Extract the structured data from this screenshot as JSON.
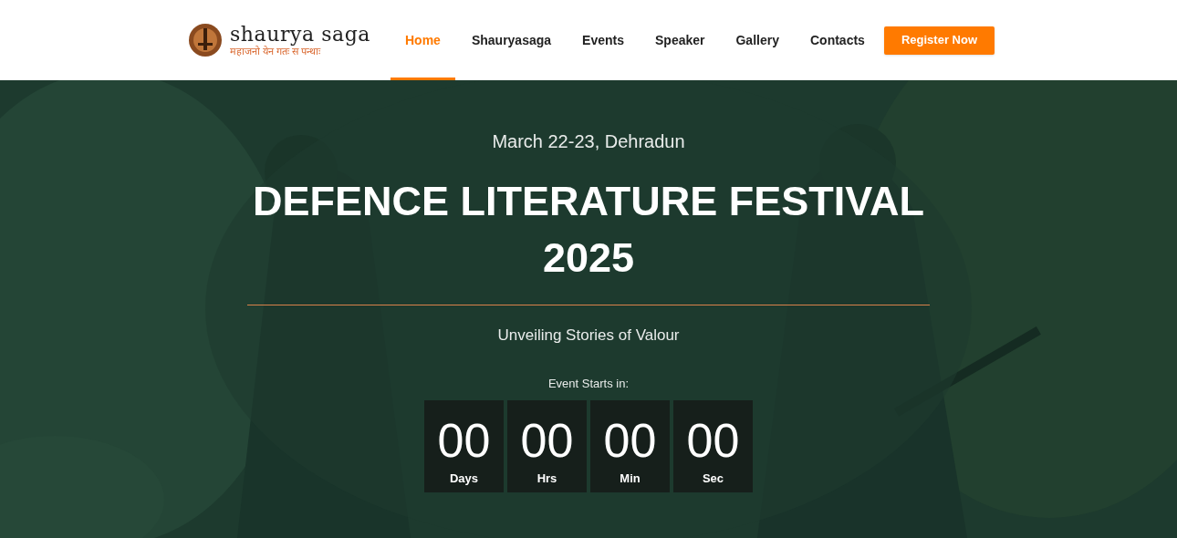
{
  "header": {
    "logo": {
      "name": "shaurya saga",
      "tagline": "महाजनो येन गतः स पन्थाः"
    },
    "nav": [
      {
        "label": "Home",
        "selected": true
      },
      {
        "label": "Shauryasaga",
        "selected": false
      },
      {
        "label": "Events",
        "selected": false
      },
      {
        "label": "Speaker",
        "selected": false
      },
      {
        "label": "Gallery",
        "selected": false
      },
      {
        "label": "Contacts",
        "selected": false
      }
    ],
    "cta": "Register Now"
  },
  "hero": {
    "date": "March 22-23, Dehradun",
    "title": "DEFENCE LITERATURE FESTIVAL 2025",
    "subtitle": "Unveiling Stories of Valour",
    "countdown_label": "Event Starts in:",
    "countdown": [
      {
        "value": "00",
        "unit": "Days"
      },
      {
        "value": "00",
        "unit": "Hrs"
      },
      {
        "value": "00",
        "unit": "Min"
      },
      {
        "value": "00",
        "unit": "Sec"
      }
    ]
  }
}
